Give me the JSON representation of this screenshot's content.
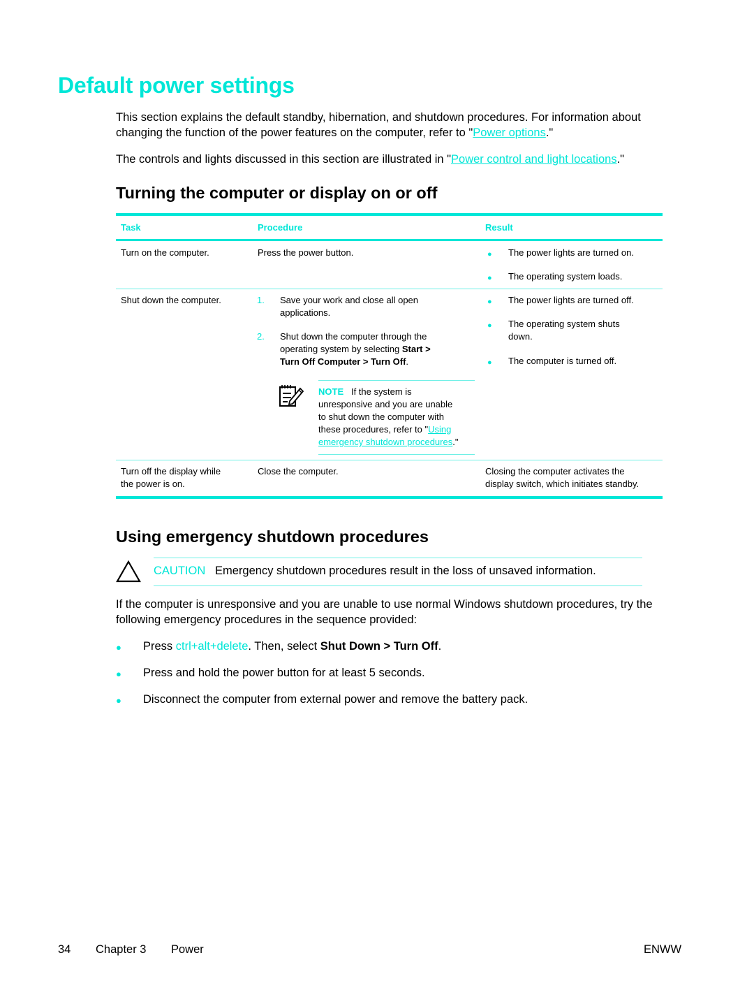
{
  "page": {
    "title": "Default power settings",
    "intro": {
      "para1_text": "This section explains the default standby, hibernation, and shutdown procedures. For information about changing the function of the power features on the computer, refer to \"",
      "para1_link": "Power options",
      "para1_end": ".\"",
      "para2_text": "The controls and lights discussed in this section are illustrated in \"",
      "para2_link": "Power control and light locations",
      "para2_end": ".\""
    },
    "section1": {
      "heading": "Turning the computer or display on or off",
      "table": {
        "headers": [
          "Task",
          "Procedure",
          "Result"
        ],
        "rows": [
          {
            "task": "Turn on the computer.",
            "procedure": "Press the power button.",
            "results": [
              "The power lights are turned on.",
              "The operating system loads."
            ]
          },
          {
            "task": "Shut down the computer.",
            "steps": [
              {
                "num": "1.",
                "line1": "Save your work and close all open",
                "line2": "applications."
              },
              {
                "num": "2.",
                "line1": "Shut down the computer through the",
                "line2a": "operating system by selecting ",
                "bold1": "Start >",
                "bold2": "Turn Off Computer > Turn Off",
                "end": "."
              }
            ],
            "note": {
              "label": "NOTE",
              "text_line1": "If the system is",
              "text_line2": "unresponsive and you are unable",
              "text_line3": "to shut down the computer with",
              "text_line4": "these procedures, refer to \"",
              "link_part1": "Using",
              "link_part2": "emergency shutdown procedures",
              "end": ".\""
            },
            "results": [
              "The power lights are turned off.",
              "The operating system shuts",
              "down.",
              "The computer is turned off."
            ]
          },
          {
            "task_line1": "Turn off the display while",
            "task_line2": "the power is on.",
            "procedure": "Close the computer.",
            "result_line1": "Closing the computer activates the",
            "result_line2": "display switch, which initiates standby."
          }
        ]
      }
    },
    "section2": {
      "heading": "Using emergency shutdown procedures",
      "caution": {
        "label": "CAUTION",
        "text": "Emergency shutdown procedures result in the loss of unsaved information."
      },
      "para": "If the computer is unresponsive and you are unable to use normal Windows shutdown procedures, try the following emergency procedures in the sequence provided:",
      "list": {
        "item1_a": "Press ",
        "item1_key": "ctrl+alt+delete",
        "item1_b": ". Then, select ",
        "item1_bold": "Shut Down > Turn Off",
        "item1_end": ".",
        "item2": "Press and hold the power button for at least 5 seconds.",
        "item3": "Disconnect the computer from external power and remove the battery pack."
      }
    },
    "footer": {
      "page_number": "34",
      "chapter": "Chapter 3",
      "chapter_title": "Power",
      "code": "ENWW"
    },
    "colors": {
      "accent": "#00e6d7",
      "text": "#000000"
    },
    "icons": {
      "bullet": "●",
      "note": "note-pencil-icon",
      "caution": "caution-triangle-icon"
    }
  }
}
